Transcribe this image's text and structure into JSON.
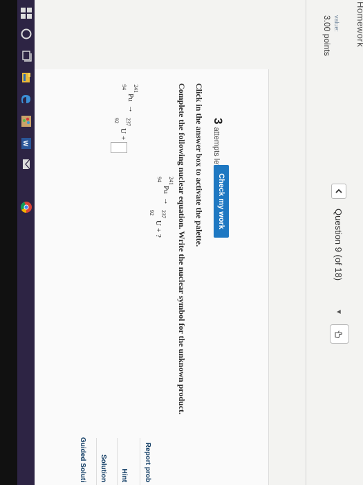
{
  "header": {
    "section_title": "Homework",
    "value_label": "value:",
    "points": "3.00 points"
  },
  "question_nav": {
    "back_icon": "chevron-left",
    "label": "Question 9 (of 18)",
    "dropdown_icon": "caret-down",
    "help_icon": "hand-pointer"
  },
  "attempts": {
    "count": "3",
    "suffix": "attempts left"
  },
  "check_button": "Check my work",
  "instructions": {
    "line1": "Click in the answer box to activate the palette.",
    "line2": "Complete the following nuclear equation. Write the nuclear symbol for the unknown product."
  },
  "equation_given": {
    "reactant_mass": "241",
    "reactant_atomic": "94",
    "reactant_symbol": "Pu",
    "arrow": "→",
    "product_mass": "237",
    "product_atomic": "92",
    "product_symbol": "U",
    "plus_unknown": "+ ?"
  },
  "equation_answer": {
    "reactant_mass": "241",
    "reactant_atomic": "94",
    "reactant_symbol": "Pu",
    "arrow": "→",
    "product_mass": "237",
    "product_atomic": "92",
    "product_symbol": "U",
    "plus": "+"
  },
  "sidebar": {
    "report": "Report prob",
    "hint": "Hint",
    "solution": "Solution",
    "guided": "Guided Soluti"
  },
  "taskbar": {
    "icons": [
      "windows-icon",
      "search-circle-icon",
      "task-view-icon",
      "file-explorer-icon",
      "edge-icon",
      "paint-icon",
      "word-icon",
      "mail-icon",
      "chrome-icon"
    ]
  },
  "colors": {
    "accent": "#1e78c2",
    "taskbar": "#2d2444"
  }
}
